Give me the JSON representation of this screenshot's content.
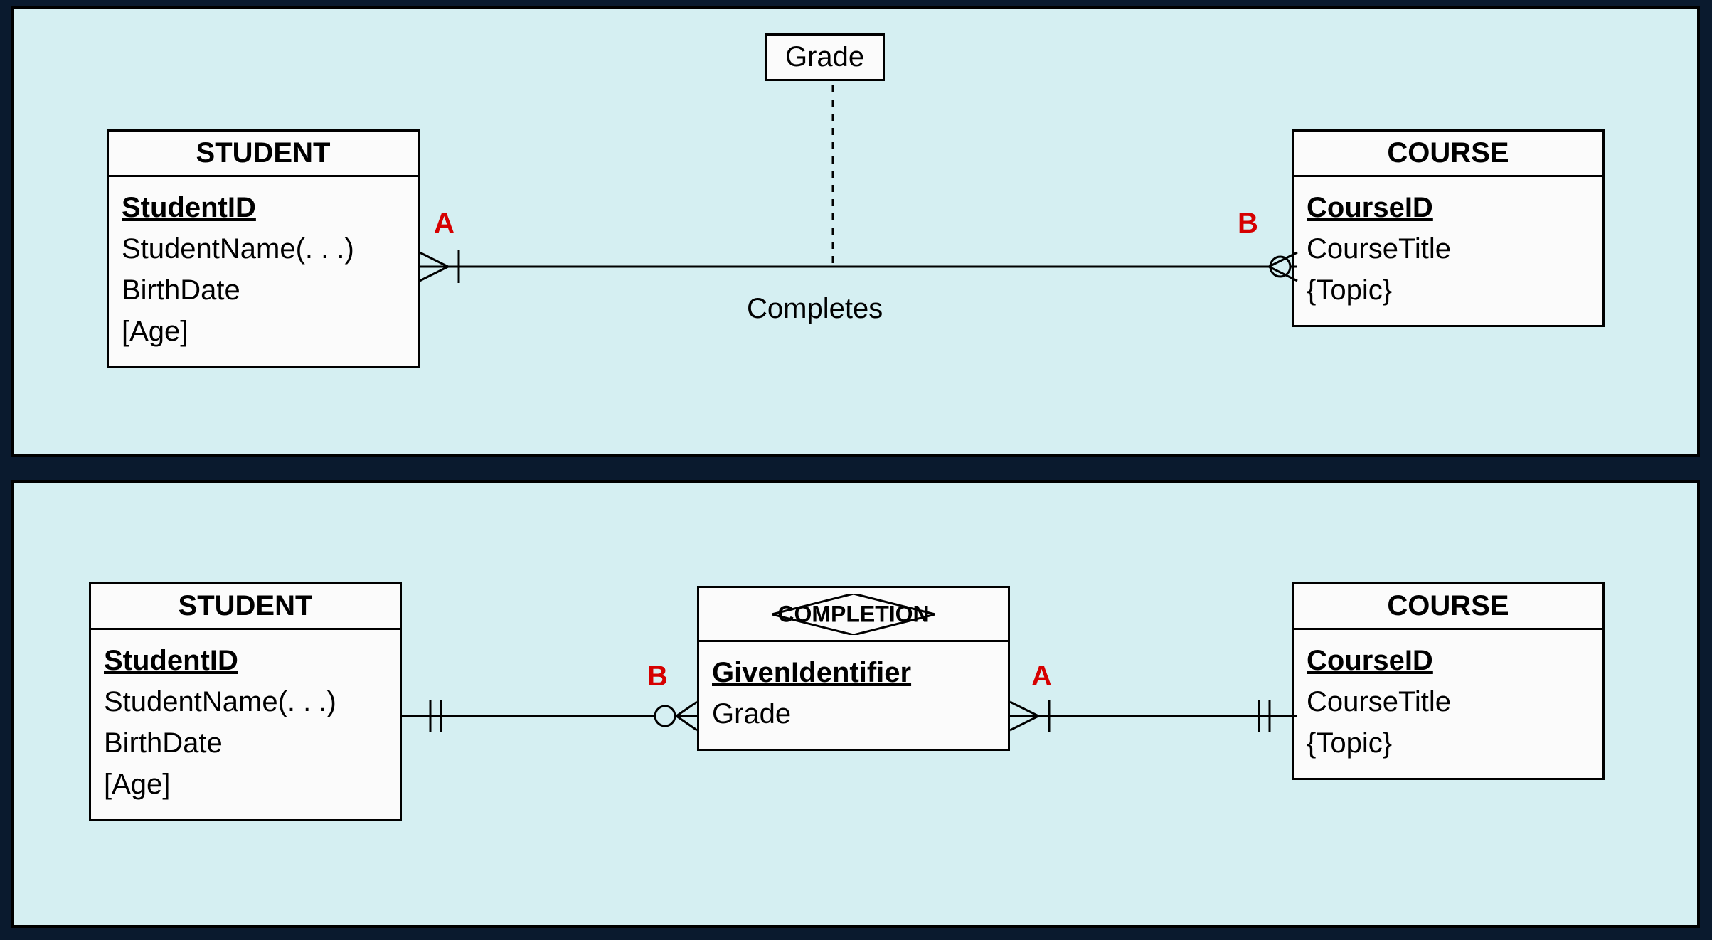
{
  "diagram_top": {
    "association_attribute": "Grade",
    "relationship_label": "Completes",
    "marker_left": "A",
    "marker_right": "B",
    "student": {
      "title": "STUDENT",
      "pk": "StudentID",
      "attrs": [
        "StudentName(. . .)",
        "BirthDate",
        "[Age]"
      ]
    },
    "course": {
      "title": "COURSE",
      "pk": "CourseID",
      "attrs": [
        "CourseTitle",
        "{Topic}"
      ]
    }
  },
  "diagram_bottom": {
    "marker_left": "B",
    "marker_right": "A",
    "student": {
      "title": "STUDENT",
      "pk": "StudentID",
      "attrs": [
        "StudentName(. . .)",
        "BirthDate",
        "[Age]"
      ]
    },
    "completion": {
      "title": "COMPLETION",
      "pk": "GivenIdentifier",
      "attrs": [
        "Grade"
      ]
    },
    "course": {
      "title": "COURSE",
      "pk": "CourseID",
      "attrs": [
        "CourseTitle",
        "{Topic}"
      ]
    }
  }
}
